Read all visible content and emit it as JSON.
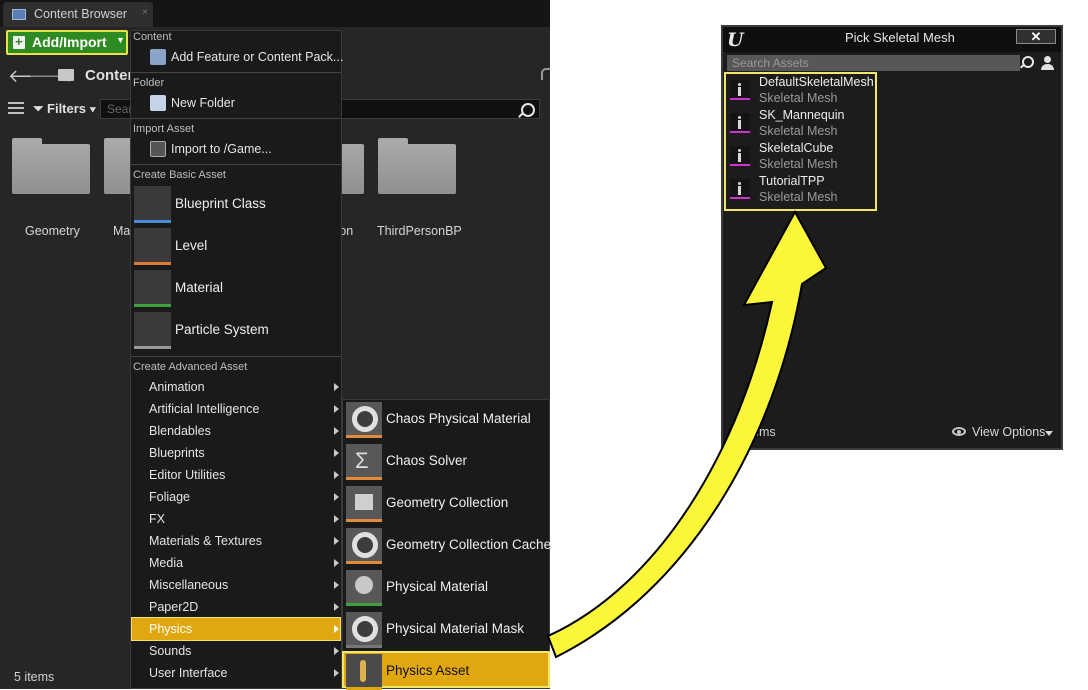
{
  "content_browser": {
    "tab_title": "Content Browser",
    "tab_close": "×",
    "add_import_label": "Add/Import",
    "path_label": "Conter",
    "filters_label": "Filters",
    "search_placeholder": "Sear",
    "folders": [
      "Geometry",
      "Ma",
      "son",
      "ThirdPersonBP"
    ],
    "items_count": "5 items"
  },
  "add_menu": {
    "content_header": "Content",
    "add_feature_label": "Add Feature or Content Pack...",
    "folder_header": "Folder",
    "new_folder_label": "New Folder",
    "import_header": "Import Asset",
    "import_label": "Import to /Game...",
    "basic_header": "Create Basic Asset",
    "basic_assets": [
      "Blueprint Class",
      "Level",
      "Material",
      "Particle System"
    ],
    "advanced_header": "Create Advanced Asset",
    "advanced_categories": [
      "Animation",
      "Artificial Intelligence",
      "Blendables",
      "Blueprints",
      "Editor Utilities",
      "Foliage",
      "FX",
      "Materials & Textures",
      "Media",
      "Miscellaneous",
      "Paper2D",
      "Physics",
      "Sounds",
      "User Interface"
    ],
    "selected_category": "Physics"
  },
  "physics_submenu": {
    "items": [
      "Chaos Physical Material",
      "Chaos Solver",
      "Geometry Collection",
      "Geometry Collection Cache",
      "Physical Material",
      "Physical Material Mask",
      "Physics Asset"
    ],
    "selected_item": "Physics Asset"
  },
  "pick_dialog": {
    "logo": "U",
    "title": "Pick Skeletal Mesh",
    "close_label": "✕",
    "search_placeholder": "Search Assets",
    "assets": [
      {
        "name": "DefaultSkeletalMesh",
        "type": "Skeletal Mesh"
      },
      {
        "name": "SK_Mannequin",
        "type": "Skeletal Mesh"
      },
      {
        "name": "SkeletalCube",
        "type": "Skeletal Mesh"
      },
      {
        "name": "TutorialTPP",
        "type": "Skeletal Mesh"
      }
    ],
    "items_label": "ems",
    "view_options_label": "View Options"
  },
  "colors": {
    "highlight": "#e0a710",
    "callout_yellow": "#fbf63a",
    "add_button_green": "#2e8b22",
    "skeletal_mesh_accent": "#cc33cc"
  }
}
